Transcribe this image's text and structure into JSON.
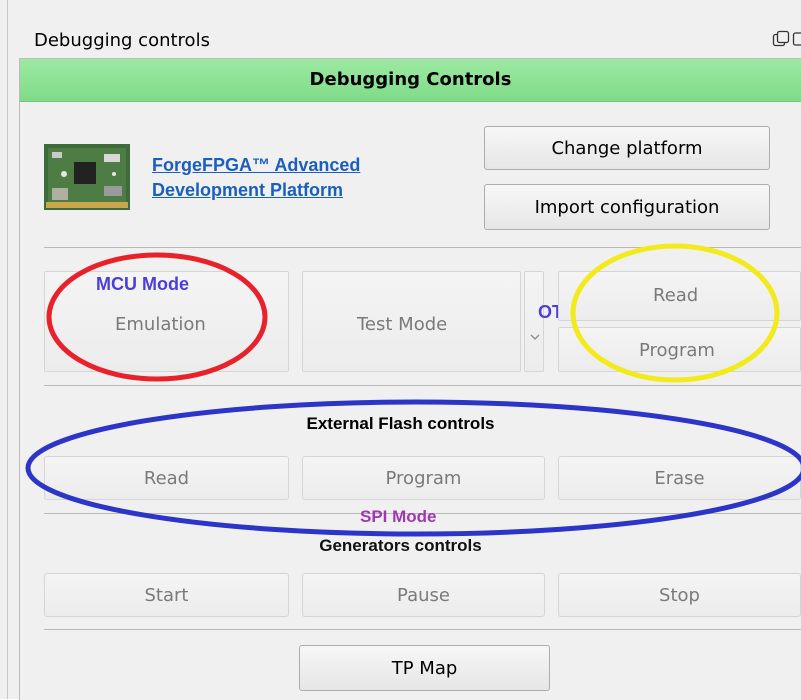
{
  "window": {
    "title": "Debugging controls"
  },
  "header": {
    "title": "Debugging Controls"
  },
  "platform": {
    "link_line1": "ForgeFPGA™ Advanced",
    "link_line2": "Development Platform",
    "change_label": "Change platform",
    "import_label": "Import configuration"
  },
  "modes": {
    "mcu_label": "MCU Mode",
    "emulation_label": "Emulation",
    "test_mode_label": "Test Mode",
    "otp_label": "OTP Mode",
    "otp_read_label": "Read",
    "otp_program_label": "Program"
  },
  "external_flash": {
    "title": "External Flash controls",
    "read_label": "Read",
    "program_label": "Program",
    "erase_label": "Erase",
    "spi_label": "SPI Mode"
  },
  "generators": {
    "title": "Generators controls",
    "start_label": "Start",
    "pause_label": "Pause",
    "stop_label": "Stop"
  },
  "footer": {
    "tp_map_label": "TP Map"
  },
  "annotation_colors": {
    "mcu": "#e8222b",
    "otp": "#f2ea1a",
    "spi": "#2d35c8",
    "header": "#8ee396"
  },
  "icons": [
    "float-window-icon",
    "close-window-icon",
    "board-image"
  ]
}
